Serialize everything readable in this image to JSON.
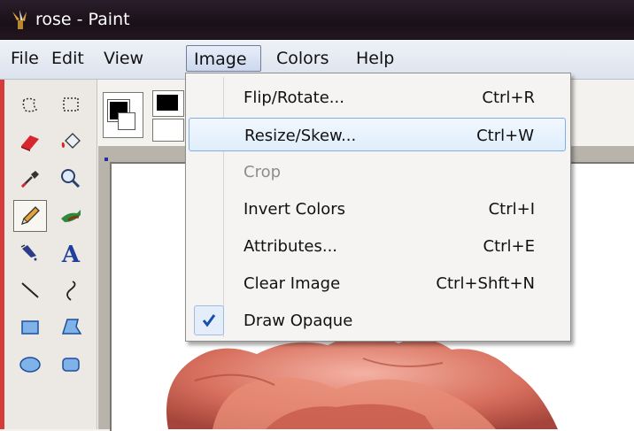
{
  "window": {
    "title": "rose - Paint"
  },
  "menubar": {
    "items": [
      {
        "label": "File"
      },
      {
        "label": "Edit"
      },
      {
        "label": "View"
      },
      {
        "label": "Image"
      },
      {
        "label": "Colors"
      },
      {
        "label": "Help"
      }
    ],
    "open_menu": "Image"
  },
  "image_menu": {
    "items": [
      {
        "label": "Flip/Rotate...",
        "shortcut": "Ctrl+R"
      },
      {
        "label": "Resize/Skew...",
        "shortcut": "Ctrl+W",
        "highlighted": true
      },
      {
        "label": "Crop",
        "shortcut": "",
        "disabled": true
      },
      {
        "label": "Invert Colors",
        "shortcut": "Ctrl+I"
      },
      {
        "label": "Attributes...",
        "shortcut": "Ctrl+E"
      },
      {
        "label": "Clear Image",
        "shortcut": "Ctrl+Shft+N"
      },
      {
        "label": "Draw Opaque",
        "shortcut": "",
        "checked": true
      }
    ]
  },
  "toolbox": {
    "tools": [
      {
        "icon": "free-form-select-icon"
      },
      {
        "icon": "rect-select-icon"
      },
      {
        "icon": "eraser-icon"
      },
      {
        "icon": "fill-bucket-icon"
      },
      {
        "icon": "color-picker-icon"
      },
      {
        "icon": "magnifier-icon"
      },
      {
        "icon": "pencil-icon",
        "selected": true
      },
      {
        "icon": "brush-icon"
      },
      {
        "icon": "airbrush-icon"
      },
      {
        "icon": "text-icon"
      },
      {
        "icon": "line-icon"
      },
      {
        "icon": "curve-icon"
      },
      {
        "icon": "rectangle-icon"
      },
      {
        "icon": "polygon-icon"
      },
      {
        "icon": "ellipse-icon"
      },
      {
        "icon": "rounded-rectangle-icon"
      }
    ]
  },
  "colors": {
    "titlebar": "#1f141c",
    "menu_highlight": "#dfeefc",
    "check_mark": "#1a4fa8"
  }
}
